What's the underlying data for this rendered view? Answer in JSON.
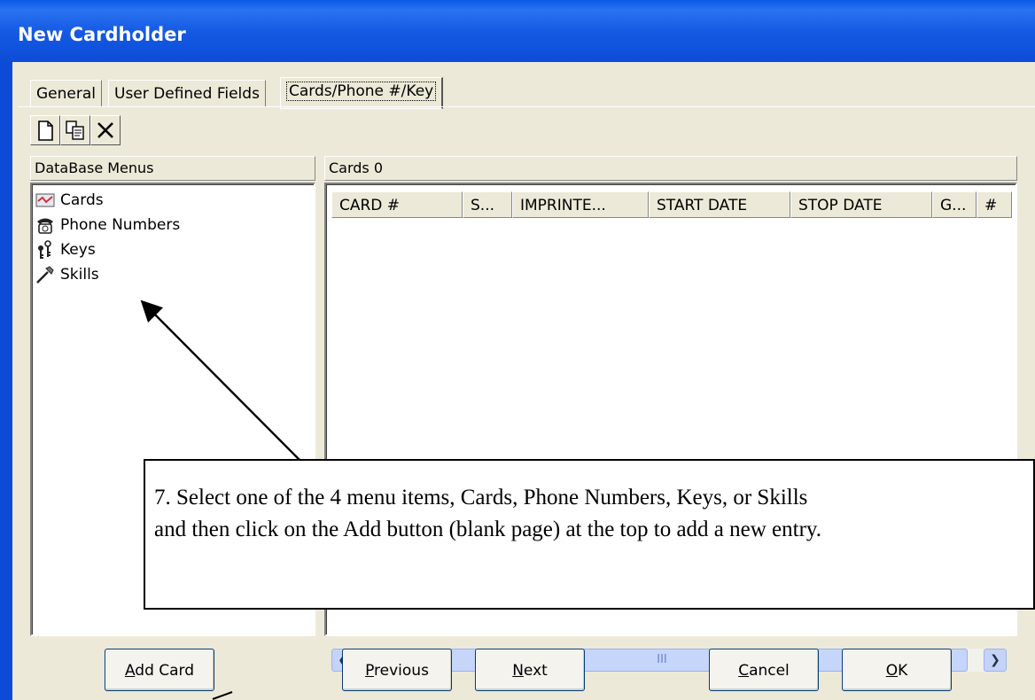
{
  "window": {
    "title": "New Cardholder"
  },
  "tabs": [
    "General",
    "User Defined Fields",
    "Cards/Phone #/Key"
  ],
  "toolbar": {
    "buttons": [
      "new-page-icon",
      "copy-icon",
      "delete-icon"
    ]
  },
  "left_panel": {
    "header": "DataBase Menus",
    "items": [
      {
        "label": "Cards",
        "icon": "card-icon"
      },
      {
        "label": "Phone Numbers",
        "icon": "phone-icon"
      },
      {
        "label": "Keys",
        "icon": "key-icon"
      },
      {
        "label": "Skills",
        "icon": "skills-icon"
      }
    ]
  },
  "right_panel": {
    "header": "Cards  0",
    "columns": [
      "CARD #",
      "S...",
      "IMPRINTE...",
      "START DATE",
      "STOP DATE",
      "G...",
      "#"
    ]
  },
  "scrollbar": {
    "grip": "III"
  },
  "buttons": {
    "add_card": {
      "accel": "A",
      "rest": "dd Card"
    },
    "previous": {
      "accel": "P",
      "rest": "revious"
    },
    "next": {
      "accel": "N",
      "rest": "ext"
    },
    "cancel": {
      "accel": "C",
      "rest": "ancel"
    },
    "ok": {
      "accel": "O",
      "rest": "K"
    }
  },
  "callout": {
    "line1": "7.   Select one of the 4 menu items, Cards, Phone Numbers, Keys, or Skills",
    "line2": "and then click on the Add button (blank page) at the top to add a new entry."
  }
}
